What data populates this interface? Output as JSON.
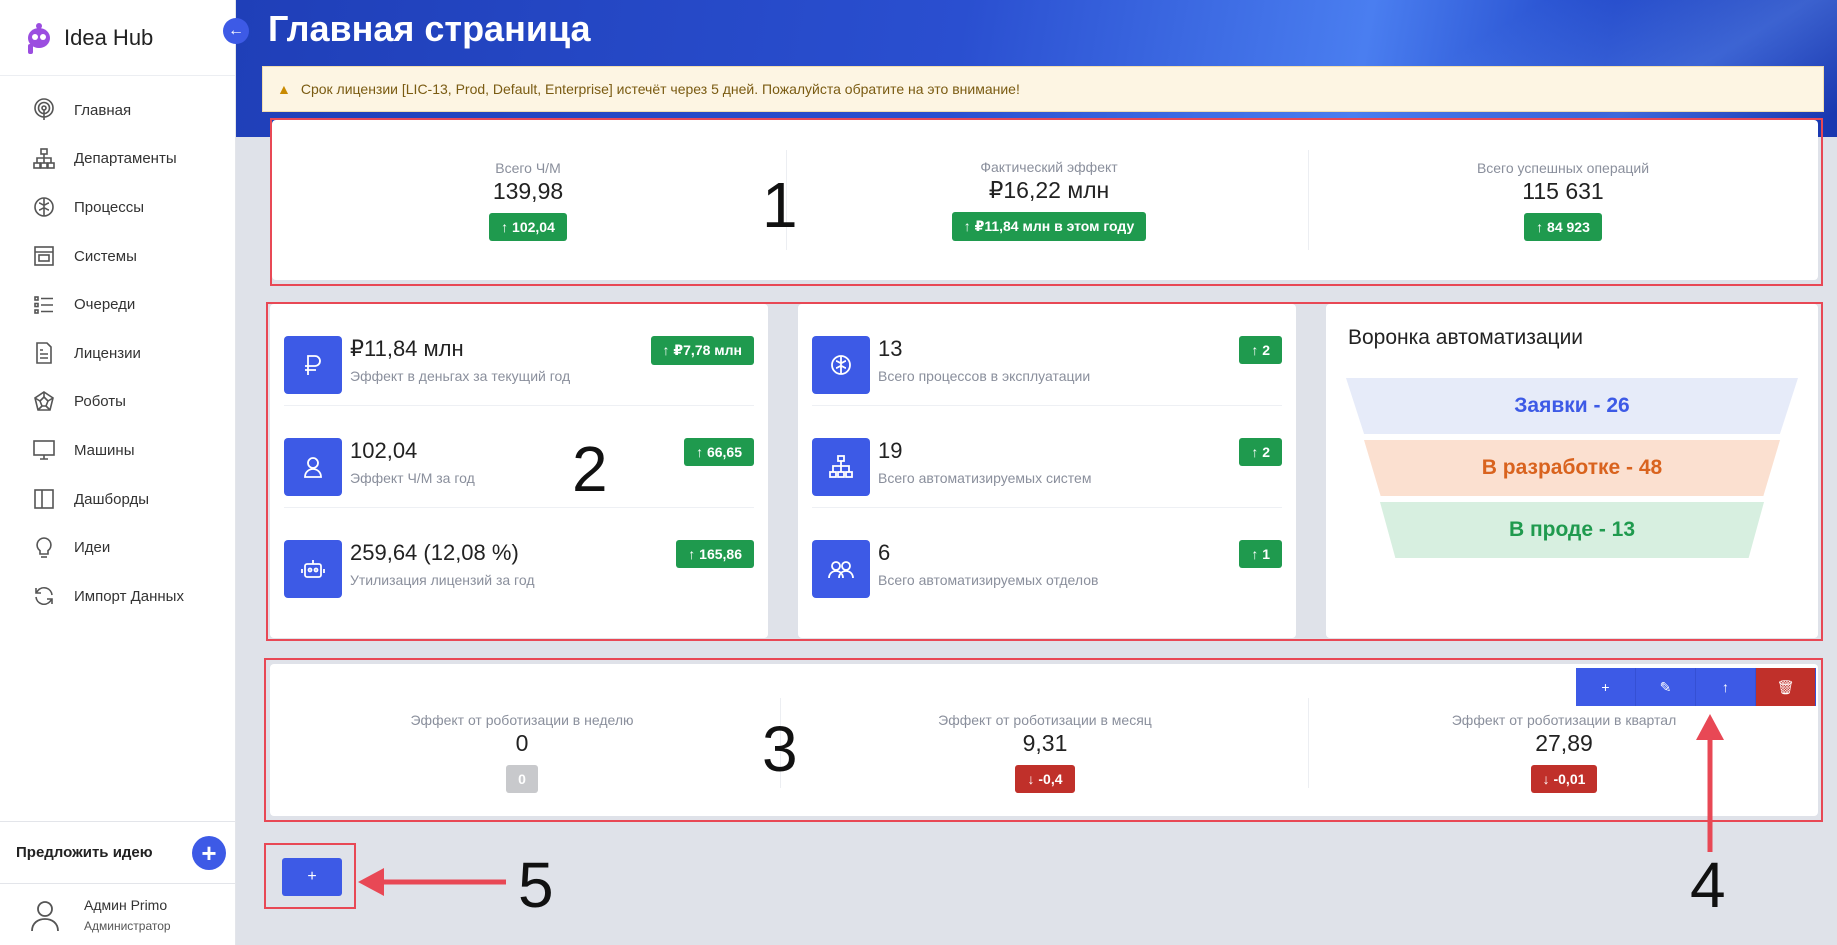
{
  "app": {
    "name": "Idea Hub"
  },
  "page": {
    "title": "Главная страница"
  },
  "alert": {
    "text": "Срок лицензии [LIC-13, Prod, Default, Enterprise] истечёт через 5 дней. Пожалуйста обратите на это внимание!"
  },
  "sidebar": {
    "items": [
      {
        "label": "Главная",
        "icon": "podcast-icon"
      },
      {
        "label": "Департаменты",
        "icon": "org-chart-icon"
      },
      {
        "label": "Процессы",
        "icon": "brain-icon"
      },
      {
        "label": "Системы",
        "icon": "window-icon"
      },
      {
        "label": "Очереди",
        "icon": "list-icon"
      },
      {
        "label": "Лицензии",
        "icon": "document-icon"
      },
      {
        "label": "Роботы",
        "icon": "polyhedron-icon"
      },
      {
        "label": "Машины",
        "icon": "monitor-icon"
      },
      {
        "label": "Дашборды",
        "icon": "columns-icon"
      },
      {
        "label": "Идеи",
        "icon": "lightbulb-icon"
      },
      {
        "label": "Импорт Данных",
        "icon": "sync-icon"
      }
    ],
    "propose_label": "Предложить идею",
    "propose_button": "+",
    "user": {
      "name": "Админ Primo",
      "role": "Администратор"
    }
  },
  "kpi_top": [
    {
      "label": "Всего Ч/М",
      "value": "139,98",
      "delta": "↑ 102,04"
    },
    {
      "label": "Фактический эффект",
      "value": "₽16,22 млн",
      "delta": "↑ ₽11,84 млн в этом году"
    },
    {
      "label": "Всего успешных операций",
      "value": "115 631",
      "delta": "↑ 84 923"
    }
  ],
  "stats_left": [
    {
      "value": "₽11,84 млн",
      "label": "Эффект в деньгах за текущий год",
      "delta": "↑ ₽7,78 млн",
      "icon": "ruble-icon"
    },
    {
      "value": "102,04",
      "label": "Эффект Ч/М за год",
      "delta": "↑ 66,65",
      "icon": "user-icon"
    },
    {
      "value": "259,64 (12,08 %)",
      "label": "Утилизация лицензий за год",
      "delta": "↑ 165,86",
      "icon": "robot-icon"
    }
  ],
  "stats_mid": [
    {
      "value": "13",
      "label": "Всего процессов в эксплуатации",
      "delta": "↑ 2",
      "icon": "brain-icon"
    },
    {
      "value": "19",
      "label": "Всего автоматизируемых систем",
      "delta": "↑ 2",
      "icon": "org-chart-icon"
    },
    {
      "value": "6",
      "label": "Всего автоматизируемых отделов",
      "delta": "↑ 1",
      "icon": "group-icon"
    }
  ],
  "funnel": {
    "title": "Воронка автоматизации",
    "steps": [
      {
        "label": "Заявки - 26",
        "bg": "#e6ebf9",
        "color": "#3d5ae6"
      },
      {
        "label": "В разработке - 48",
        "bg": "#fbe0d0",
        "color": "#d9631e"
      },
      {
        "label": "В проде - 13",
        "bg": "#d7efe0",
        "color": "#1f9a4e"
      }
    ]
  },
  "kpi_bottom": [
    {
      "label": "Эффект от роботизации в неделю",
      "value": "0",
      "delta": "0",
      "status": "neutral"
    },
    {
      "label": "Эффект от роботизации в месяц",
      "value": "9,31",
      "delta": "↓ -0,4",
      "status": "down"
    },
    {
      "label": "Эффект от роботизации в квартал",
      "value": "27,89",
      "delta": "↓ -0,01",
      "status": "down"
    }
  ],
  "toolbar": {
    "add": "+",
    "edit": "✎",
    "up": "↑",
    "delete": "🗑"
  },
  "add_widget_button": "+",
  "annotations": [
    "1",
    "2",
    "3",
    "4",
    "5"
  ],
  "colors": {
    "accent": "#3d5ae6",
    "success": "#1f9a4e",
    "danger": "#c0302a",
    "highlight": "#e84855"
  }
}
